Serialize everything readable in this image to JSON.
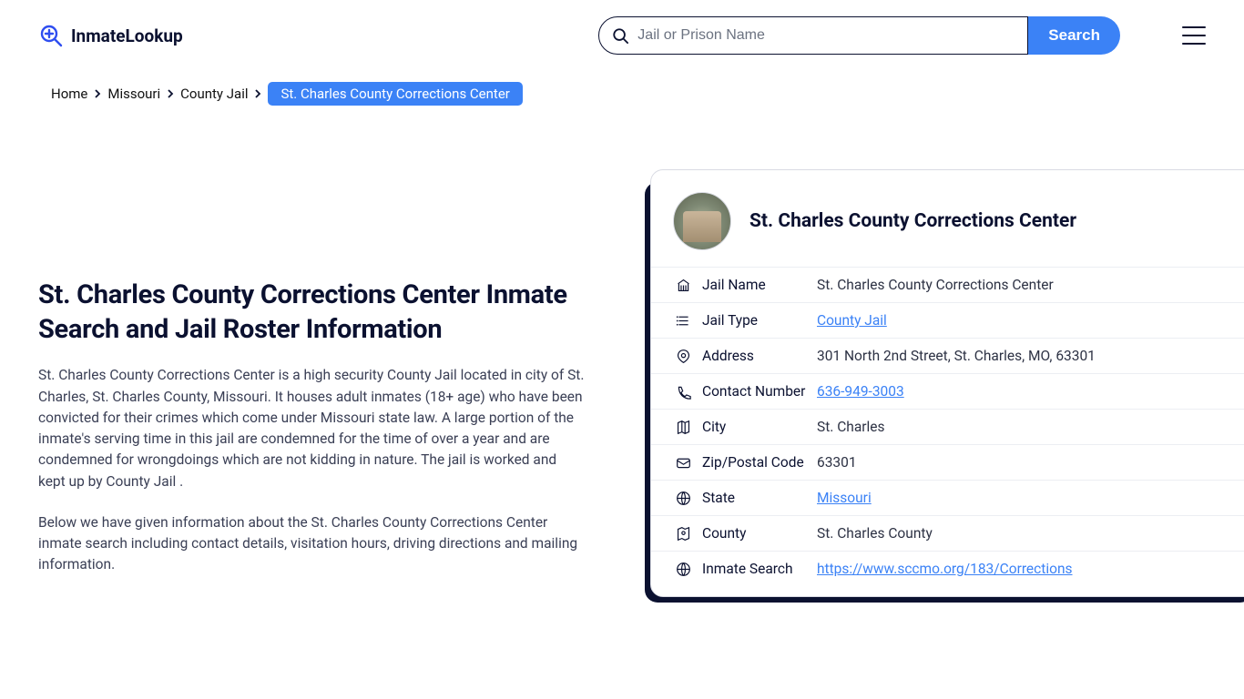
{
  "brand": {
    "name": "InmateLookup"
  },
  "search": {
    "placeholder": "Jail or Prison Name",
    "button": "Search"
  },
  "breadcrumb": {
    "items": [
      "Home",
      "Missouri",
      "County Jail"
    ],
    "current": "St. Charles County Corrections Center"
  },
  "main": {
    "title": "St. Charles County Corrections Center Inmate Search and Jail Roster Information",
    "p1": "St. Charles County Corrections Center is a high security County Jail located in city of St. Charles, St. Charles County, Missouri. It houses adult inmates (18+ age) who have been convicted for their crimes which come under Missouri state law. A large portion of the inmate's serving time in this jail are condemned for the time of over a year and are condemned for wrongdoings which are not kidding in nature. The jail is worked and kept up by County Jail .",
    "p2": "Below we have given information about the St. Charles County Corrections Center inmate search including contact details, visitation hours, driving directions and mailing information."
  },
  "card": {
    "title": "St. Charles County Corrections Center",
    "rows": [
      {
        "label": "Jail Name",
        "value": "St. Charles County Corrections Center",
        "link": false
      },
      {
        "label": "Jail Type",
        "value": "County Jail",
        "link": true
      },
      {
        "label": "Address",
        "value": "301 North 2nd Street, St. Charles, MO, 63301",
        "link": false
      },
      {
        "label": "Contact Number",
        "value": "636-949-3003",
        "link": true
      },
      {
        "label": "City",
        "value": "St. Charles",
        "link": false
      },
      {
        "label": "Zip/Postal Code",
        "value": "63301",
        "link": false
      },
      {
        "label": "State",
        "value": "Missouri",
        "link": true
      },
      {
        "label": "County",
        "value": "St. Charles County",
        "link": false
      },
      {
        "label": "Inmate Search",
        "value": "https://www.sccmo.org/183/Corrections",
        "link": true
      }
    ]
  }
}
